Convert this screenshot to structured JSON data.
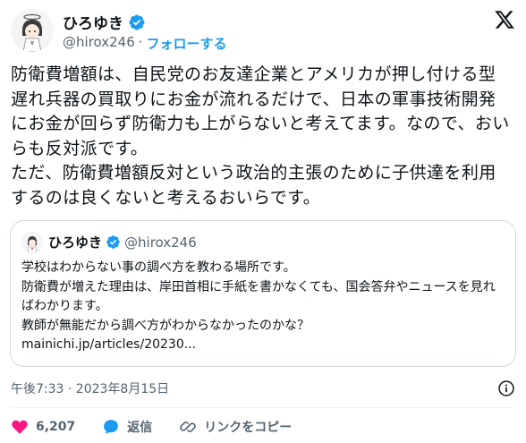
{
  "author": {
    "display_name": "ひろゆき",
    "handle": "@hirox246",
    "separator": "·",
    "follow_label": "フォローする"
  },
  "tweet": {
    "text": "防衛費増額は、自民党のお友達企業とアメリカが押し付ける型遅れ兵器の買取りにお金が流れるだけで、日本の軍事技術開発にお金が回らず防衛力も上がらないと考えてます。なので、おいらも反対派です。\nただ、防衛費増額反対という政治的主張のために子供達を利用するのは良くないと考えるおいらです。"
  },
  "quoted_tweet": {
    "display_name": "ひろゆき",
    "handle": "@hirox246",
    "text": "学校はわからない事の調べ方を教わる場所です。\n防衛費が増えた理由は、岸田首相に手紙を書かなくても、国会答弁やニュースを見ればわかります。\n教師が無能だから調べ方がわからなかったのかな？\nmainichi.jp/articles/20230..."
  },
  "meta": {
    "timestamp": "午後7:33 · 2023年8月15日"
  },
  "actions": {
    "likes": "6,207",
    "reply_label": "返信",
    "copy_link_label": "リンクをコピー"
  },
  "colors": {
    "accent": "#1d9bf0",
    "like": "#f91880",
    "muted": "#536471",
    "text": "#0f1419",
    "border": "#cfd9de"
  },
  "icons": [
    "verified-badge-icon",
    "x-logo-icon",
    "info-icon",
    "heart-icon",
    "reply-icon",
    "link-icon"
  ]
}
